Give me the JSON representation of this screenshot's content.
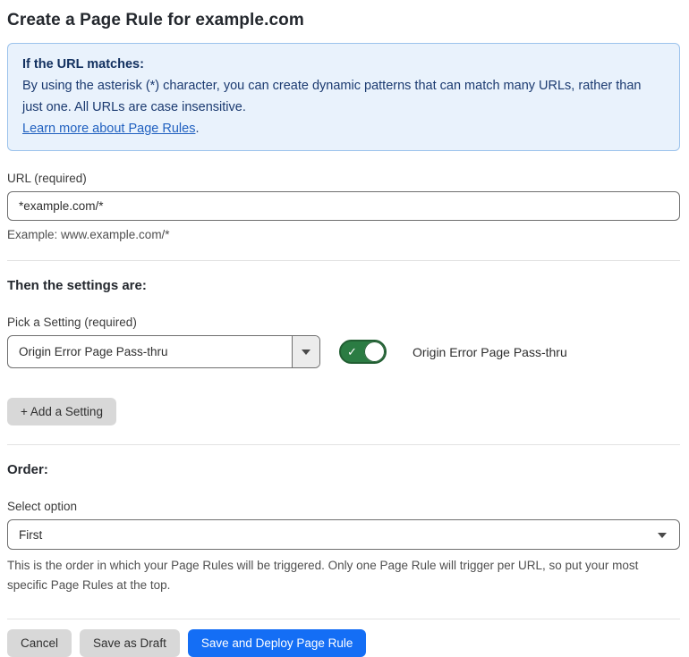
{
  "page": {
    "title": "Create a Page Rule for example.com"
  },
  "info_box": {
    "heading": "If the URL matches:",
    "body": "By using the asterisk (*) character, you can create dynamic patterns that can match many URLs, rather than just one. All URLs are case insensitive.",
    "link": "Learn more about Page Rules",
    "link_suffix": "."
  },
  "url_field": {
    "label": "URL (required)",
    "value": "*example.com/*",
    "helper": "Example: www.example.com/*"
  },
  "settings_section": {
    "heading": "Then the settings are:",
    "picker_label": "Pick a Setting (required)",
    "picker_value": "Origin Error Page Pass-thru",
    "toggle_state": "on",
    "toggle_label": "Origin Error Page Pass-thru",
    "add_button": "+ Add a Setting"
  },
  "order_section": {
    "heading": "Order:",
    "select_label": "Select option",
    "select_value": "First",
    "helper": "This is the order in which your Page Rules will be triggered. Only one Page Rule will trigger per URL, so put your most specific Page Rules at the top."
  },
  "footer": {
    "cancel": "Cancel",
    "save_draft": "Save as Draft",
    "save_deploy": "Save and Deploy Page Rule"
  },
  "icons": {
    "check": "✓"
  },
  "colors": {
    "primary_blue": "#146ef5",
    "info_bg": "#e9f2fc",
    "info_border": "#9cc3ec",
    "info_text": "#1b3a70",
    "link_blue": "#2161c0",
    "toggle_green": "#2b7c43",
    "button_gray": "#d8d8d8"
  }
}
